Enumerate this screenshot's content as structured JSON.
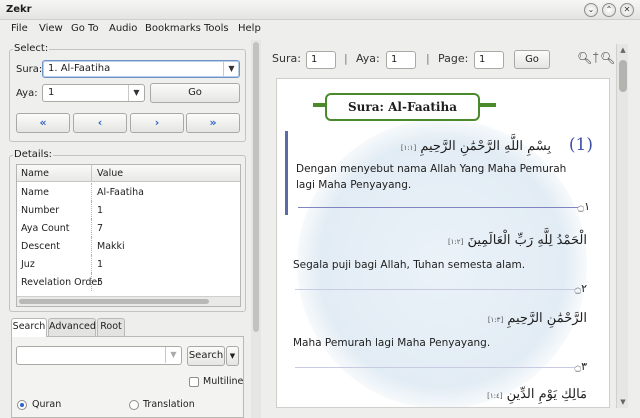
{
  "window": {
    "title": "Zekr",
    "buttons": [
      "⌄",
      "⌃",
      "✕"
    ]
  },
  "menu": [
    {
      "label": "File",
      "name": "menu-file"
    },
    {
      "label": "View",
      "name": "menu-view"
    },
    {
      "label": "Go To",
      "name": "menu-goto"
    },
    {
      "label": "Audio",
      "name": "menu-audio"
    },
    {
      "label": "Bookmarks",
      "name": "menu-bookmarks"
    },
    {
      "label": "Tools",
      "name": "menu-tools"
    },
    {
      "label": "Help",
      "name": "menu-help"
    }
  ],
  "select": {
    "group_label": "Select:",
    "sura_label": "Sura:",
    "sura_value": "1. Al-Faatiha",
    "aya_label": "Aya:",
    "aya_value": "1",
    "go_label": "Go",
    "nav": {
      "first": "«",
      "prev": "‹",
      "next": "›",
      "last": "»"
    }
  },
  "details": {
    "group_label": "Details:",
    "columns": [
      "Name",
      "Value"
    ],
    "rows": [
      {
        "name": "Name",
        "value": "Al-Faatiha"
      },
      {
        "name": "Number",
        "value": "1"
      },
      {
        "name": "Aya Count",
        "value": "7"
      },
      {
        "name": "Descent",
        "value": "Makki"
      },
      {
        "name": "Juz",
        "value": "1"
      },
      {
        "name": "Revelation Order",
        "value": "5"
      }
    ]
  },
  "search": {
    "tabs": [
      "Search",
      "Advanced",
      "Root"
    ],
    "active_tab": "Search",
    "input_value": "",
    "button_label": "Search",
    "multiline_label": "Multiline",
    "radio_quran": "Quran",
    "radio_translation": "Translation",
    "selected_radio": "Quran"
  },
  "viewer_toolbar": {
    "sura_label": "Sura:",
    "sura_value": "1",
    "aya_label": "Aya:",
    "aya_value": "1",
    "page_label": "Page:",
    "page_value": "1",
    "go_label": "Go",
    "separator": "|",
    "zoom_out_icon": "−",
    "zoom_in_icon": "+"
  },
  "viewer": {
    "sura_title": "Sura: Al-Faatiha",
    "ayas": [
      {
        "number": "(1)",
        "arabic": "بِسْمِ اللَّهِ الرَّحْمَٰنِ الرَّحِيمِ",
        "ref": "[١:١]",
        "translation": "Dengan menyebut nama Allah Yang Maha Pemurah lagi Maha Penyayang.",
        "end_mark": "۝١"
      },
      {
        "number": "",
        "arabic": "الْحَمْدُ لِلَّهِ رَبِّ الْعَالَمِينَ",
        "ref": "[١:٢]",
        "translation": "Segala puji bagi Allah, Tuhan semesta alam.",
        "end_mark": "۝٢"
      },
      {
        "number": "",
        "arabic": "الرَّحْمَٰنِ الرَّحِيمِ",
        "ref": "[١:٣]",
        "translation": "Maha Pemurah lagi Maha Penyayang.",
        "end_mark": "۝٣"
      },
      {
        "number": "",
        "arabic": "مَالِكِ يَوْمِ الدِّينِ",
        "ref": "[١:٤]",
        "translation": "",
        "end_mark": ""
      }
    ],
    "accent_color": "#4a8a2a",
    "highlight_color": "#5a6ba8"
  }
}
